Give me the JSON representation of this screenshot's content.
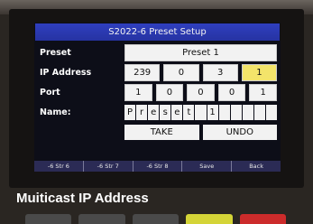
{
  "screen": {
    "title": "S2022-6 Preset Setup",
    "rows": {
      "preset": {
        "label": "Preset",
        "value": "Preset 1"
      },
      "ip": {
        "label": "IP Address",
        "octets": [
          "239",
          "0",
          "3",
          "1"
        ],
        "selected_index": 3
      },
      "port": {
        "label": "Port",
        "digits": [
          "1",
          "0",
          "0",
          "0",
          "1"
        ]
      },
      "name": {
        "label": "Name:",
        "chars": [
          "P",
          "r",
          "e",
          "s",
          "e",
          "t",
          " ",
          "1",
          " ",
          " ",
          " ",
          " ",
          " "
        ]
      }
    },
    "actions": {
      "take": "TAKE",
      "undo": "UNDO"
    },
    "softkeys": [
      "-6 Str 6",
      "-6 Str 7",
      "-6 Str 8",
      "Save",
      "Back"
    ]
  },
  "caption": "Muiticast IP Address",
  "colors": {
    "title_bar": "#2f3fbf",
    "highlight": "#f3e46a",
    "button_colors": [
      "#4a4a4a",
      "#4a4a4a",
      "#4a4a4a",
      "#d4d437",
      "#cc2b2b"
    ]
  }
}
